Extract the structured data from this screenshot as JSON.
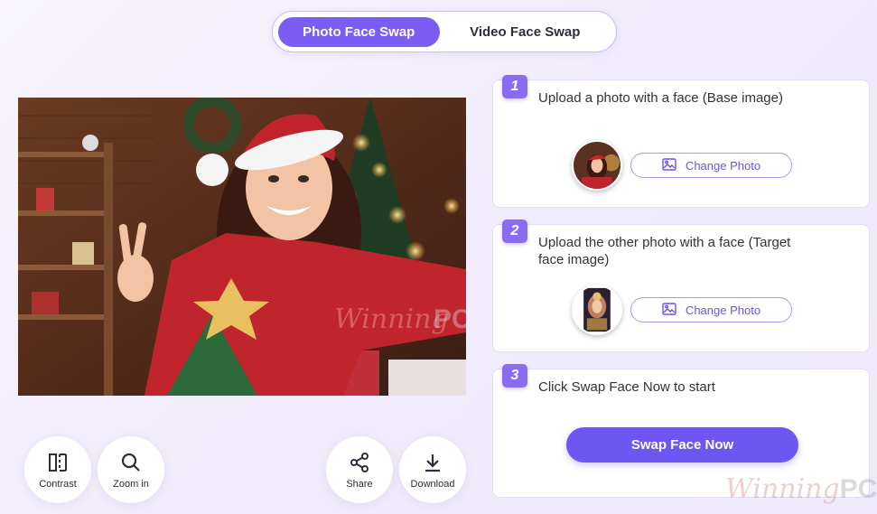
{
  "tabs": [
    {
      "label": "Photo Face Swap",
      "active": true
    },
    {
      "label": "Video Face Swap",
      "active": false
    }
  ],
  "tools_left": [
    {
      "label": "Contrast",
      "icon": "contrast-icon"
    },
    {
      "label": "Zoom in",
      "icon": "zoom-in-icon"
    }
  ],
  "tools_right": [
    {
      "label": "Share",
      "icon": "share-icon"
    },
    {
      "label": "Download",
      "icon": "download-icon"
    }
  ],
  "steps": [
    {
      "number": "1",
      "text": "Upload a photo with a face (Base image)",
      "button": "Change Photo"
    },
    {
      "number": "2",
      "text": "Upload the other photo with a face (Target face image)",
      "button": "Change Photo"
    },
    {
      "number": "3",
      "text": "Click Swap Face Now to start",
      "button": "Swap Face Now"
    }
  ],
  "watermark": {
    "script": "Winning",
    "bold": "PC"
  },
  "colors": {
    "accent": "#7b5cf5",
    "swap_button": "#6d56f2",
    "badge": "#8b6cf0"
  }
}
